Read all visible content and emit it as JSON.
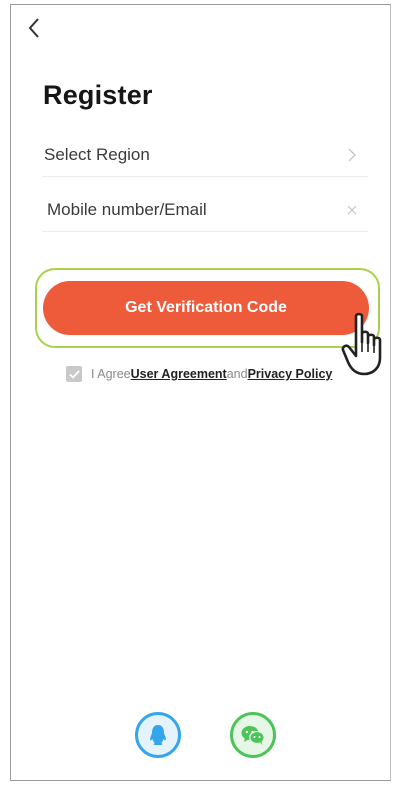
{
  "header": {
    "back_icon": "chevron-left-icon"
  },
  "page": {
    "title": "Register"
  },
  "form": {
    "region_label": "Select Region",
    "region_icon": "chevron-right-icon",
    "mobile_placeholder": "Mobile number/Email",
    "clear_icon": "close-icon"
  },
  "actions": {
    "verify_label": "Get Verification Code",
    "highlight_color": "#a9d24a",
    "button_color": "#ee5b3b"
  },
  "agreement": {
    "checked": true,
    "prefix": "I Agree",
    "user_agreement": "User Agreement",
    "and": "and",
    "privacy_policy": "Privacy Policy"
  },
  "social": {
    "qq_icon": "qq-penguin-icon",
    "qq_color": "#35a6ec",
    "wechat_icon": "wechat-icon",
    "wechat_color": "#4ec35a"
  }
}
